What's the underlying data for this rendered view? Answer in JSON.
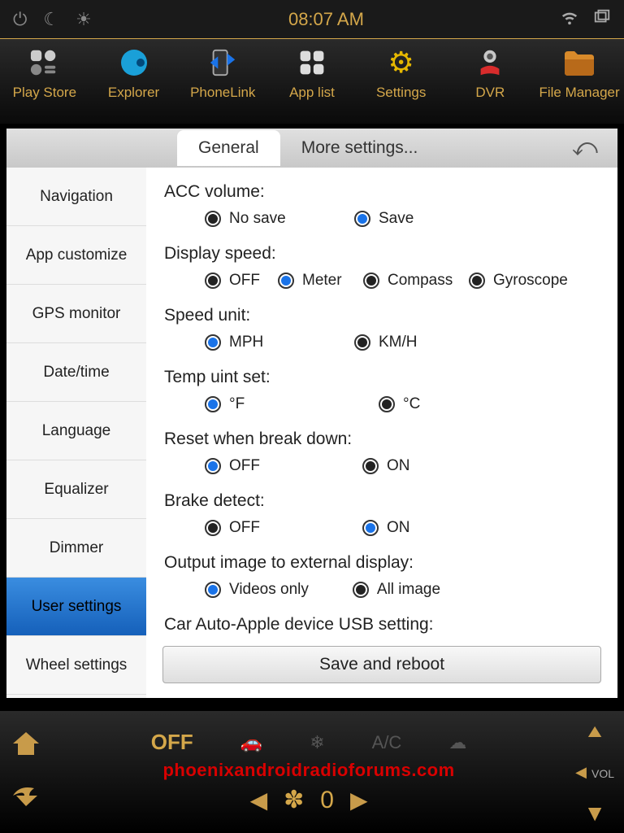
{
  "status": {
    "time": "08:07 AM"
  },
  "dock": [
    {
      "label": "Play Store",
      "icon": "playstore"
    },
    {
      "label": "Explorer",
      "icon": "explorer"
    },
    {
      "label": "PhoneLink",
      "icon": "phonelink"
    },
    {
      "label": "App list",
      "icon": "applist"
    },
    {
      "label": "Settings",
      "icon": "settings"
    },
    {
      "label": "DVR",
      "icon": "dvr"
    },
    {
      "label": "File Manager",
      "icon": "filemanager"
    }
  ],
  "tabs": {
    "general": "General",
    "more": "More settings..."
  },
  "sidebar": [
    "Navigation",
    "App customize",
    "GPS monitor",
    "Date/time",
    "Language",
    "Equalizer",
    "Dimmer",
    "User settings",
    "Wheel settings"
  ],
  "settings": {
    "acc_volume": {
      "label": "ACC volume:",
      "options": [
        "No save",
        "Save"
      ],
      "selected": 1
    },
    "display_speed": {
      "label": "Display speed:",
      "options": [
        "OFF",
        "Meter",
        "Compass",
        "Gyroscope"
      ],
      "selected": 1
    },
    "speed_unit": {
      "label": "Speed unit:",
      "options": [
        "MPH",
        "KM/H"
      ],
      "selected": 0
    },
    "temp_unit": {
      "label": "Temp uint set:",
      "options": [
        "°F",
        "°C"
      ],
      "selected": 0
    },
    "reset_break": {
      "label": "Reset when break down:",
      "options": [
        "OFF",
        "ON"
      ],
      "selected": 0
    },
    "brake_detect": {
      "label": "Brake detect:",
      "options": [
        "OFF",
        "ON"
      ],
      "selected": 1
    },
    "output_image": {
      "label": "Output image to external display:",
      "options": [
        "Videos only",
        "All image"
      ],
      "selected": 0
    },
    "car_auto": {
      "label": "Car Auto-Apple device USB setting:"
    }
  },
  "save_btn": "Save and reboot",
  "bottom": {
    "off": "OFF",
    "ac": "A/C",
    "fan_level": "0",
    "vol_label": "VOL",
    "watermark": "phoenixandroidradioforums.com"
  }
}
